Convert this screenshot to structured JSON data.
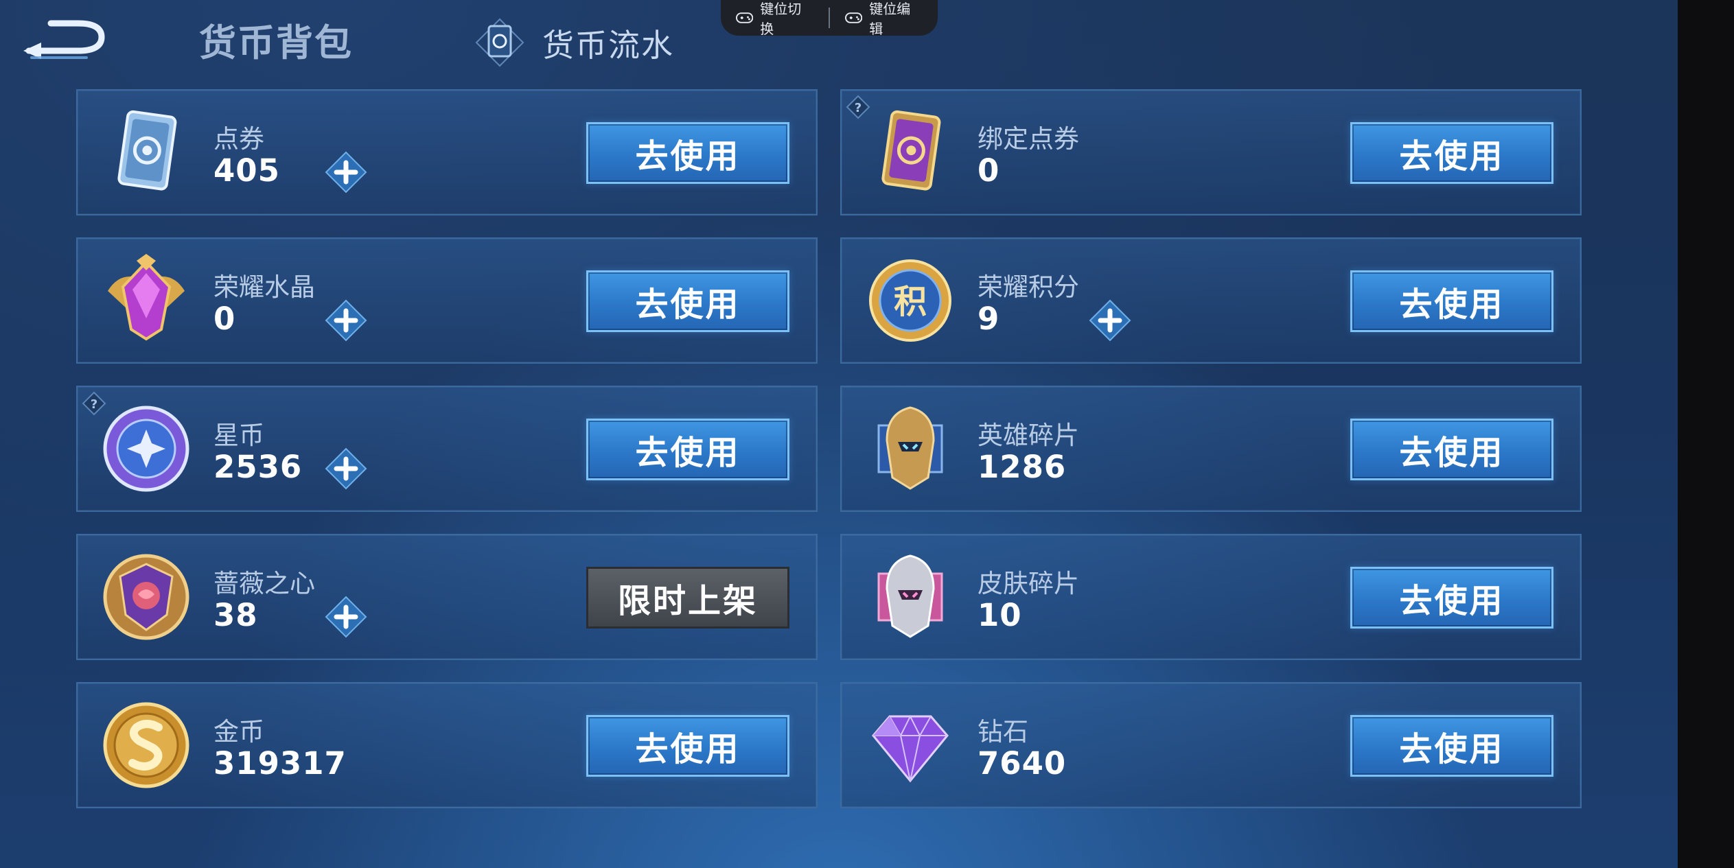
{
  "header": {
    "tab_bag": "货币背包",
    "tab_flow": "货币流水"
  },
  "keymap": {
    "switch_label": "键位切换",
    "edit_label": "键位编辑"
  },
  "currencies": [
    {
      "name": "点券",
      "value": "405",
      "button": "去使用",
      "icon": "coupon-icon"
    },
    {
      "name": "绑定点券",
      "value": "0",
      "button": "去使用",
      "icon": "bound-coupon-icon"
    },
    {
      "name": "荣耀水晶",
      "value": "0",
      "button": "去使用",
      "icon": "glory-crystal-icon"
    },
    {
      "name": "荣耀积分",
      "value": "9",
      "button": "去使用",
      "icon": "glory-points-icon"
    },
    {
      "name": "星币",
      "value": "2536",
      "button": "去使用",
      "icon": "star-coin-icon"
    },
    {
      "name": "英雄碎片",
      "value": "1286",
      "button": "去使用",
      "icon": "hero-fragment-icon"
    },
    {
      "name": "蔷薇之心",
      "value": "38",
      "button": "限时上架",
      "icon": "rose-heart-icon"
    },
    {
      "name": "皮肤碎片",
      "value": "10",
      "button": "去使用",
      "icon": "skin-fragment-icon"
    },
    {
      "name": "金币",
      "value": "319317",
      "button": "去使用",
      "icon": "gold-coin-icon"
    },
    {
      "name": "钻石",
      "value": "7640",
      "button": "去使用",
      "icon": "diamond-icon"
    }
  ],
  "icon_glyphs": {
    "integral_badge": "积"
  },
  "colors": {
    "accent": "#3f97e3",
    "button_border": "#7cc1f5",
    "card_border": "#3b6a9e",
    "disabled": "#4a4f56"
  }
}
